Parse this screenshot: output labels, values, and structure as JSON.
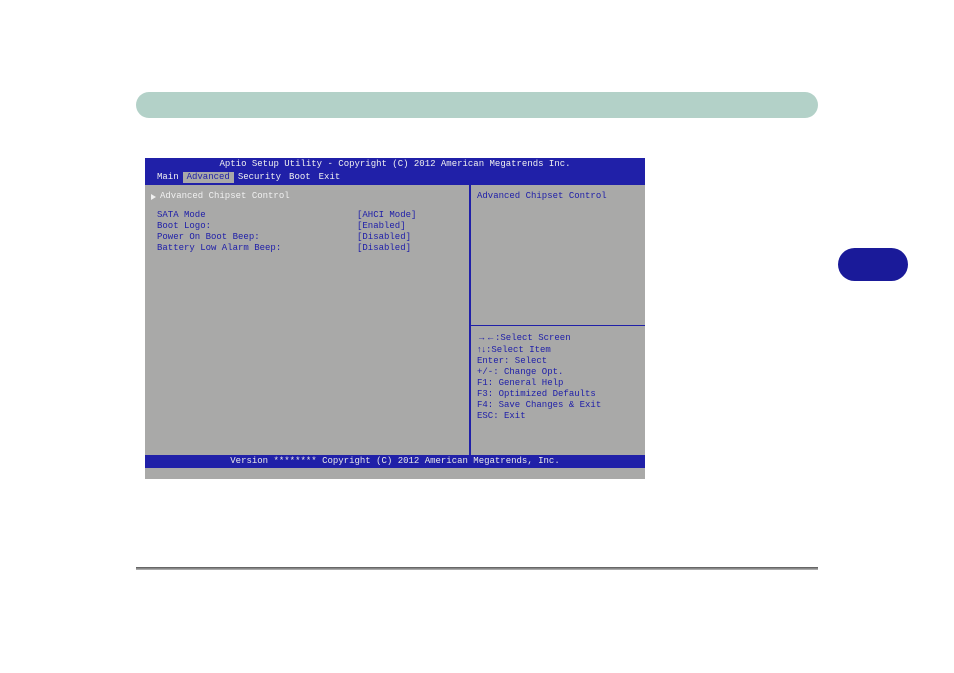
{
  "bios": {
    "title": "Aptio Setup Utility - Copyright (C) 2012 American Megatrends Inc.",
    "footer": "Version ******** Copyright (C) 2012 American Megatrends, Inc.",
    "menu": {
      "items": [
        "Main",
        "Advanced",
        "Security",
        "Boot",
        "Exit"
      ],
      "active_index": 1
    },
    "left": {
      "heading": "Advanced Chipset Control",
      "settings": [
        {
          "label": "SATA Mode",
          "value": "[AHCI Mode]"
        },
        {
          "label": "Boot Logo:",
          "value": "[Enabled]"
        },
        {
          "label": "Power On Boot Beep:",
          "value": "[Disabled]"
        },
        {
          "label": "Battery Low Alarm Beep:",
          "value": "[Disabled]"
        }
      ]
    },
    "right_top": "Advanced Chipset Control",
    "help": {
      "select_screen": ":Select Screen",
      "select_item": ":Select Item",
      "select": "Enter: Select",
      "change": "+/-: Change Opt.",
      "f1": "F1: General Help",
      "f3": "F3: Optimized Defaults",
      "f4": "F4: Save Changes & Exit",
      "esc": "ESC: Exit"
    }
  }
}
